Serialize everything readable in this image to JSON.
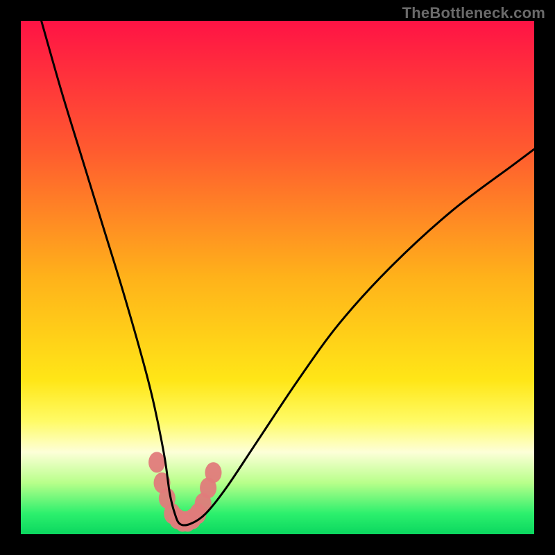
{
  "watermark": "TheBottleneck.com",
  "chart_data": {
    "type": "line",
    "title": "",
    "xlabel": "",
    "ylabel": "",
    "xlim": [
      0,
      100
    ],
    "ylim": [
      0,
      100
    ],
    "grid": false,
    "legend": false,
    "series": [
      {
        "name": "curve",
        "x": [
          4,
          8,
          12,
          16,
          20,
          24,
          26,
          28,
          29,
          30,
          31,
          33,
          36,
          40,
          46,
          54,
          62,
          72,
          84,
          96,
          100
        ],
        "y": [
          100,
          86,
          73,
          60,
          47,
          33,
          25,
          15,
          8,
          4,
          2,
          2,
          4,
          9,
          18,
          30,
          41,
          52,
          63,
          72,
          75
        ]
      }
    ],
    "annotations": {
      "markers_near_minimum": [
        {
          "x": 26.5,
          "y": 14
        },
        {
          "x": 27.5,
          "y": 10
        },
        {
          "x": 28.5,
          "y": 7
        },
        {
          "x": 29.5,
          "y": 4
        },
        {
          "x": 30.5,
          "y": 3
        },
        {
          "x": 31.5,
          "y": 2.5
        },
        {
          "x": 32.5,
          "y": 2.5
        },
        {
          "x": 33.5,
          "y": 3
        },
        {
          "x": 34.5,
          "y": 4
        },
        {
          "x": 35.5,
          "y": 6
        },
        {
          "x": 36.5,
          "y": 9
        },
        {
          "x": 37.5,
          "y": 12
        }
      ]
    },
    "background": {
      "type": "vertical_gradient",
      "stops": [
        {
          "pos": 0.0,
          "color": "#ff1345"
        },
        {
          "pos": 0.25,
          "color": "#ff5a2f"
        },
        {
          "pos": 0.5,
          "color": "#ffb21a"
        },
        {
          "pos": 0.7,
          "color": "#ffe617"
        },
        {
          "pos": 0.78,
          "color": "#fffb66"
        },
        {
          "pos": 0.84,
          "color": "#fdffd8"
        },
        {
          "pos": 0.9,
          "color": "#b8ff8a"
        },
        {
          "pos": 0.96,
          "color": "#2cf06d"
        },
        {
          "pos": 1.0,
          "color": "#0bd75f"
        }
      ]
    }
  }
}
